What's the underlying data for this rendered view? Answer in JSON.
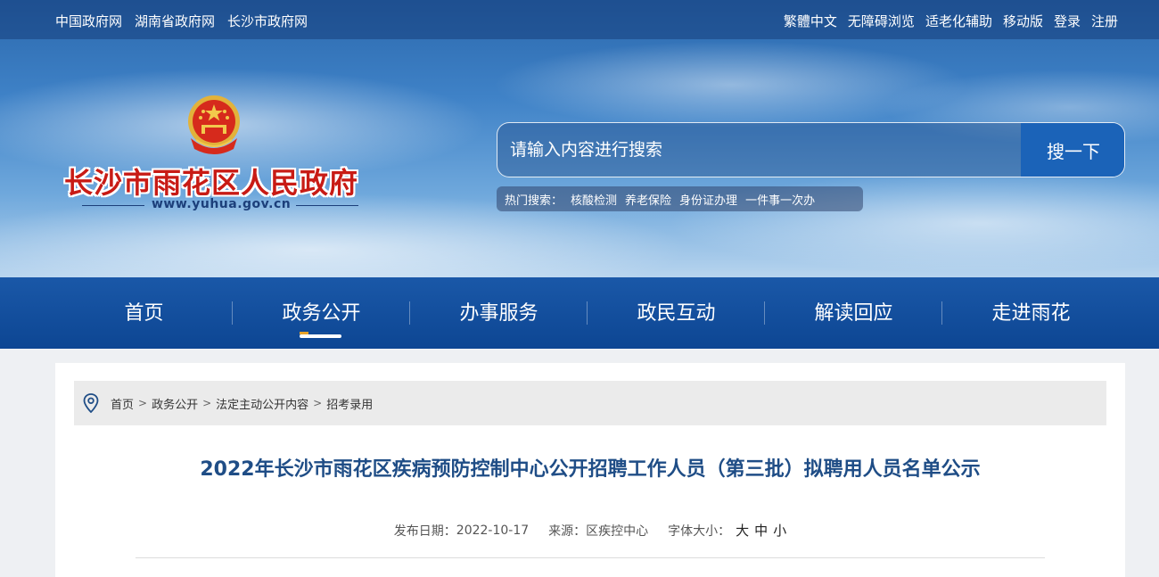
{
  "topbar": {
    "left_links": [
      "中国政府网",
      "湖南省政府网",
      "长沙市政府网"
    ],
    "right_links": [
      "繁體中文",
      "无障碍浏览",
      "适老化辅助",
      "移动版",
      "登录",
      "注册"
    ]
  },
  "logo": {
    "title": "长沙市雨花区人民政府",
    "domain": "www.yuhua.gov.cn"
  },
  "search": {
    "placeholder": "请输入内容进行搜索",
    "button_label": "搜一下",
    "hot_label": "热门搜索：",
    "hot_items": [
      "核酸检测",
      "养老保险",
      "身份证办理",
      "一件事一次办"
    ]
  },
  "nav": {
    "items": [
      "首页",
      "政务公开",
      "办事服务",
      "政民互动",
      "解读回应",
      "走进雨花"
    ],
    "active": "政务公开"
  },
  "breadcrumb": [
    "首页",
    "政务公开",
    "法定主动公开内容",
    "招考录用"
  ],
  "article": {
    "title": "2022年长沙市雨花区疾病预防控制中心公开招聘工作人员（第三批）拟聘用人员名单公示",
    "date_label": "发布日期：",
    "date": "2022-10-17",
    "source_label": "来源：",
    "source": "区疾控中心",
    "font_size_label": "字体大小：",
    "font_sizes": [
      "大",
      "中",
      "小"
    ]
  },
  "colors": {
    "nav_bg": "#0d4693",
    "title_red": "#c81b15",
    "article_title": "#1f4d86",
    "search_button": "#1b63b8"
  }
}
